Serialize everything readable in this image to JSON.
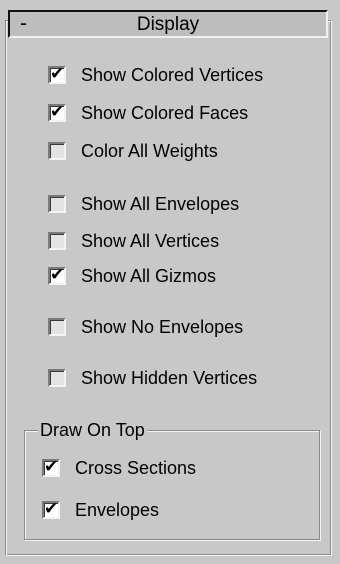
{
  "rollout": {
    "collapse_symbol": "-",
    "title": "Display"
  },
  "options": [
    {
      "label": "Show Colored Vertices",
      "checked": true
    },
    {
      "label": "Show Colored Faces",
      "checked": true
    },
    {
      "label": "Color All Weights",
      "checked": false
    },
    {
      "label": "Show All Envelopes",
      "checked": false
    },
    {
      "label": "Show All Vertices",
      "checked": false
    },
    {
      "label": "Show All Gizmos",
      "checked": true
    },
    {
      "label": "Show No Envelopes",
      "checked": false
    },
    {
      "label": "Show Hidden Vertices",
      "checked": false
    }
  ],
  "draw_on_top": {
    "title": "Draw On Top",
    "options": [
      {
        "label": "Cross Sections",
        "checked": true
      },
      {
        "label": "Envelopes",
        "checked": true
      }
    ]
  },
  "check_glyph": "✔"
}
